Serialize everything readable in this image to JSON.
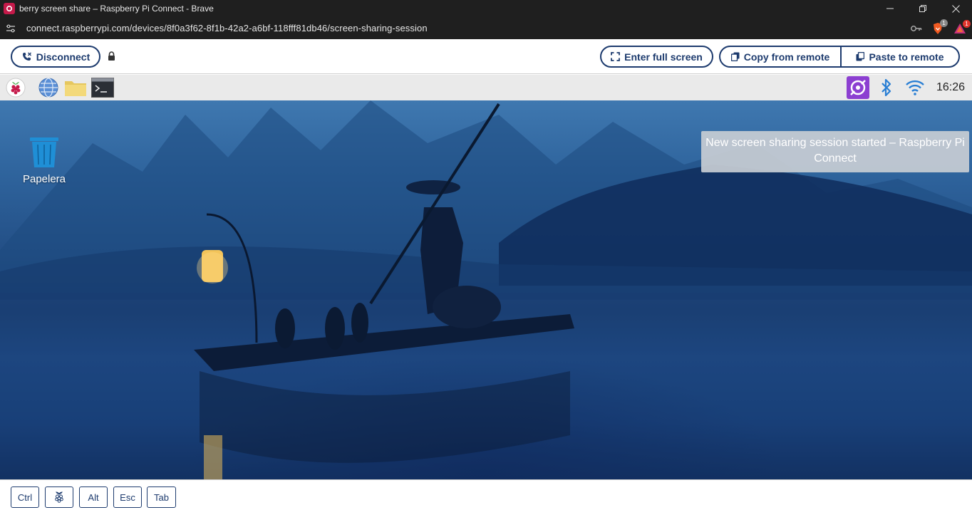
{
  "window": {
    "title": "berry screen share – Raspberry Pi Connect - Brave"
  },
  "address_bar": {
    "url": "connect.raspberrypi.com/devices/8f0a3f62-8f1b-42a2-a6bf-118fff81db46/screen-sharing-session",
    "brave_shield_count": "1",
    "rewards_count": "1"
  },
  "toolbar": {
    "disconnect_label": "Disconnect",
    "fullscreen_label": "Enter full screen",
    "copy_label": "Copy from remote",
    "paste_label": "Paste to remote"
  },
  "remote_desktop": {
    "taskbar": {
      "apps": [
        "raspberry-menu",
        "web-browser",
        "file-manager",
        "terminal"
      ],
      "tray": [
        "rpi-connect-icon",
        "bluetooth-icon",
        "wifi-icon"
      ],
      "clock": "16:26"
    },
    "desktop_icons": [
      {
        "label": "Papelera",
        "icon": "trash-icon"
      }
    ],
    "notification": "New screen sharing session started – Raspberry Pi Connect"
  },
  "keys": [
    "Ctrl",
    "",
    "Alt",
    "Esc",
    "Tab"
  ],
  "colors": {
    "brand_blue": "#1d3b6e",
    "raspberry": "#c51a4a",
    "browser_chrome": "#1f1f1f"
  }
}
